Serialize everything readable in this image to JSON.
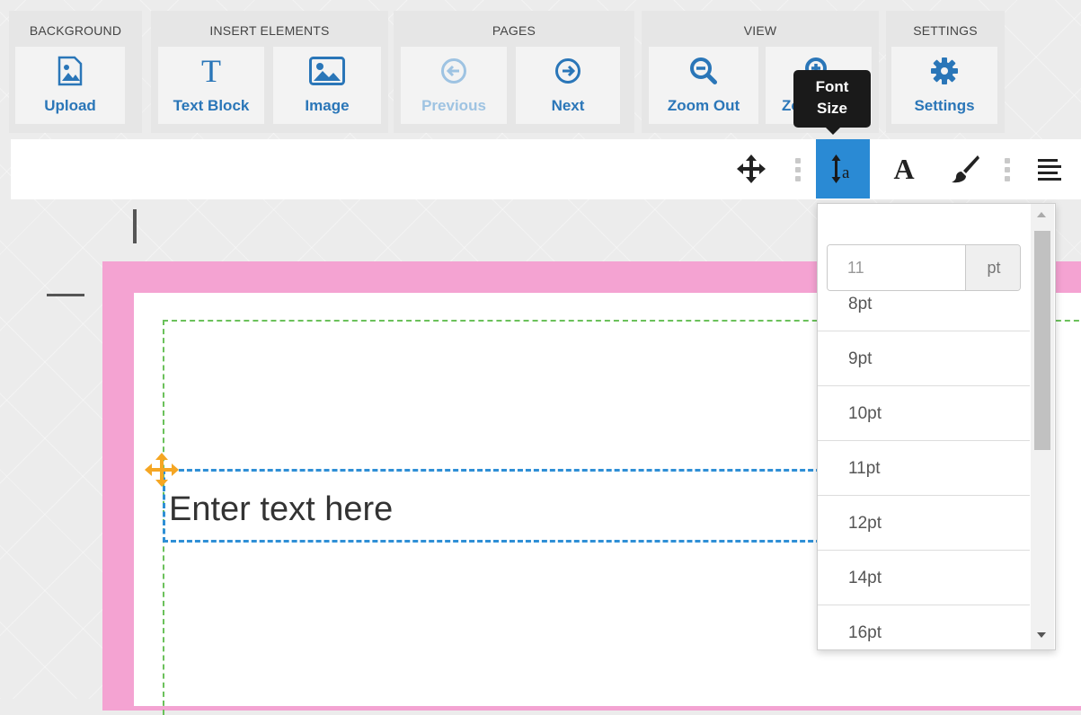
{
  "toolbar": {
    "groups": [
      {
        "title": "BACKGROUND",
        "buttons": [
          {
            "label": "Upload",
            "icon": "image-upload-icon"
          }
        ]
      },
      {
        "title": "INSERT ELEMENTS",
        "buttons": [
          {
            "label": "Text Block",
            "icon": "text-t-icon"
          },
          {
            "label": "Image",
            "icon": "image-icon"
          }
        ]
      },
      {
        "title": "PAGES",
        "buttons": [
          {
            "label": "Previous",
            "icon": "arrow-left-circle-icon",
            "disabled": true
          },
          {
            "label": "Next",
            "icon": "arrow-right-circle-icon"
          }
        ]
      },
      {
        "title": "VIEW",
        "buttons": [
          {
            "label": "Zoom Out",
            "icon": "zoom-out-icon"
          },
          {
            "label": "Zo",
            "icon": "zoom-in-icon"
          }
        ]
      },
      {
        "title": "SETTINGS",
        "buttons": [
          {
            "label": "Settings",
            "icon": "gear-icon"
          }
        ]
      }
    ]
  },
  "tooltip": {
    "line1": "Font",
    "line2": "Size"
  },
  "formatbar": {
    "icons": [
      "move-icon",
      "font-size-icon",
      "font-family-icon",
      "paintbrush-icon",
      "align-left-icon"
    ],
    "active": "font-size-icon",
    "font_family_glyph": "A",
    "font_size_glyph": "a"
  },
  "editor": {
    "text_block": "Enter text here"
  },
  "font_size_dropdown": {
    "input_value": "11",
    "unit": "pt",
    "options": [
      "8pt",
      "9pt",
      "10pt",
      "11pt",
      "12pt",
      "14pt",
      "16pt"
    ]
  },
  "colors": {
    "accent": "#2a76b8",
    "page_border": "#f4a3d2",
    "active_tool": "#2a8ad4",
    "handle": "#f5a623"
  }
}
